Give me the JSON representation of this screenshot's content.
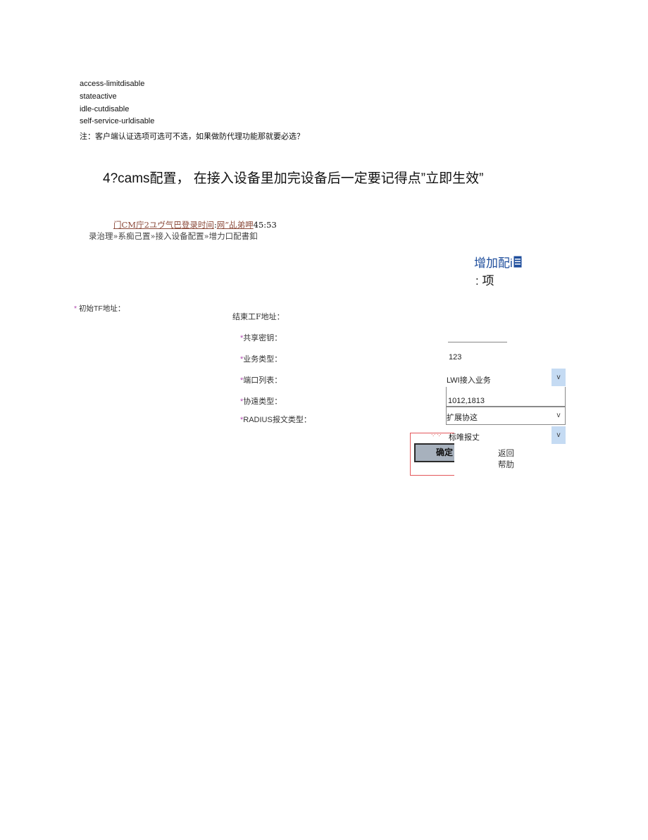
{
  "config_lines": [
    "access-limitdisable",
    "stateactive",
    "idle-cutdisable",
    "self-service-urldisable"
  ],
  "note": "注：客户端认证选项可选可不选，如果做防代理功能那就要必选？",
  "heading": "4?cams配置，  在接入设备里加完设备后一定要记得点”立即生效”",
  "status_bar": {
    "part1": "门CM庁2",
    "part2": "ユ",
    "part3": "ヴ气巴登录时间",
    "sep": ":",
    "part4": "网”乩弟呷",
    "time": "45:53"
  },
  "breadcrumb": "录治理»系痴己置»接入设备配置»增力口配書釦",
  "add_config": {
    "title": "增加配i",
    "title_icon": "document-icon",
    "subtitle": ": 项"
  },
  "form": {
    "start_ip_label": "初始TF地址：",
    "end_ip_label": "结東工F地址：",
    "shared_key_label": "共享密钥：",
    "service_type_label": "业务类型：",
    "service_type_value": "123",
    "port_list_label": "端口列表：",
    "port_list_value": "LWI接入业务",
    "protocol_type_label": "协遠类型：",
    "protocol_type_value": "1012,1813",
    "radius_type_label": "RADIUS报文类型：",
    "extend_protocol_value": "扩展协这",
    "standard_message_value": "标唯报丈",
    "dropdown_arrow": "v",
    "required_mark": "*"
  },
  "buttons": {
    "ok": "确定",
    "back": "返回",
    "help": "帮肋"
  },
  "colors": {
    "link": "#8b4a3a",
    "title_blue": "#1f4e9c",
    "required": "#b04ab0",
    "select_arrow_bg": "#c5dbf3",
    "highlight_border": "#e4575a"
  }
}
